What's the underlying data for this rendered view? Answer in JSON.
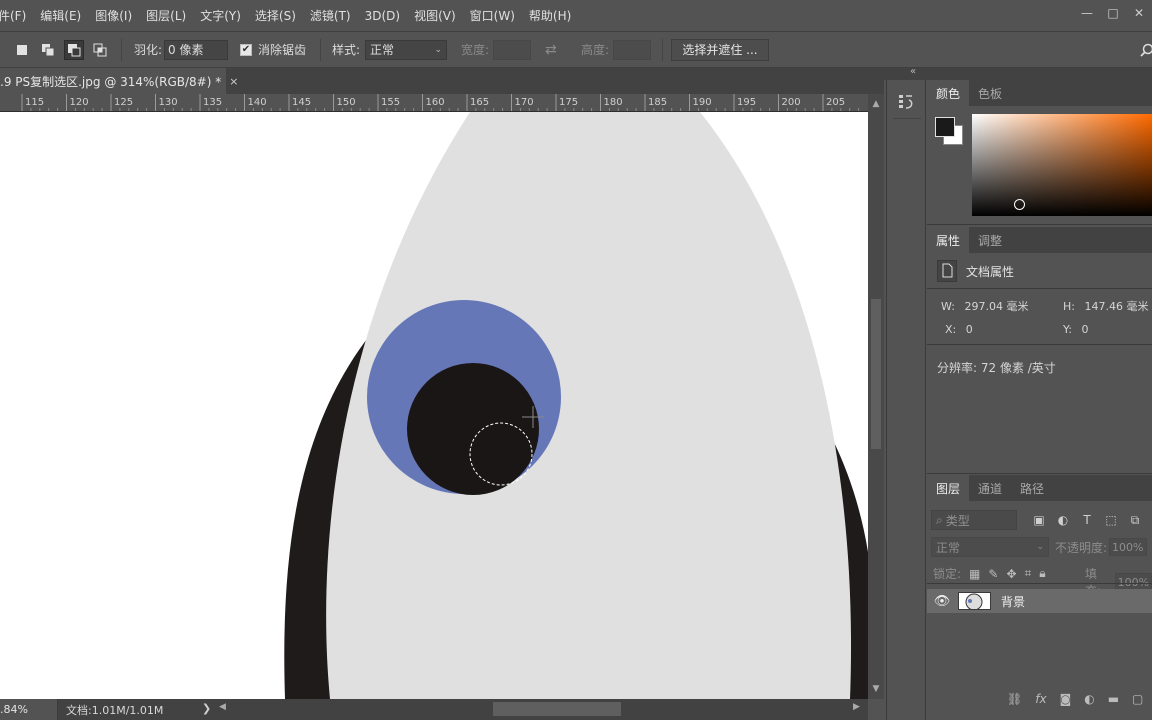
{
  "menubar": {
    "items": [
      "件(F)",
      "编辑(E)",
      "图像(I)",
      "图层(L)",
      "文字(Y)",
      "选择(S)",
      "滤镜(T)",
      "3D(D)",
      "视图(V)",
      "窗口(W)",
      "帮助(H)"
    ],
    "window_controls": [
      "—",
      "□",
      "✕"
    ]
  },
  "options": {
    "feather_label": "羽化:",
    "feather_value": "0 像素",
    "antialias_label": "消除锯齿",
    "antialias_checked": true,
    "style_label": "样式:",
    "style_value": "正常",
    "width_label": "宽度:",
    "height_label": "高度:",
    "select_mask_button": "选择并遮住 ..."
  },
  "document": {
    "tab_title": ".9 PS复制选区.jpg @ 314%(RGB/8#) *",
    "close": "×"
  },
  "ruler": {
    "labels": [
      "115",
      "120",
      "125",
      "130",
      "135",
      "140",
      "145",
      "150",
      "155",
      "160",
      "165",
      "170",
      "175",
      "180",
      "185",
      "190",
      "195",
      "200",
      "205"
    ]
  },
  "status": {
    "zoom": ".84%",
    "doc_info": "文档:1.01M/1.01M",
    "arrow": "❯"
  },
  "color_panel": {
    "tabs": [
      "颜色",
      "色板"
    ],
    "active_tab": 0,
    "foreground": "#1a1a1a",
    "background": "#ffffff",
    "hue": "#ff6a00"
  },
  "properties_panel": {
    "tabs": [
      "属性",
      "调整"
    ],
    "active_tab": 0,
    "heading": "文档属性",
    "w_label": "W:",
    "w_value": "297.04 毫米",
    "h_label": "H:",
    "h_value": "147.46 毫米",
    "x_label": "X:",
    "x_value": "0",
    "y_label": "Y:",
    "y_value": "0",
    "resolution": "分辨率: 72 像素 /英寸"
  },
  "layers_panel": {
    "tabs": [
      "图层",
      "通道",
      "路径"
    ],
    "active_tab": 0,
    "filter_placeholder": "类型",
    "blend_mode": "正常",
    "opacity_label": "不透明度:",
    "opacity_value": "100%",
    "lock_label": "锁定:",
    "fill_label": "填充:",
    "fill_value": "100%",
    "layers": [
      {
        "name": "背景",
        "visible": true
      }
    ]
  },
  "canvas": {
    "face_color": "#e0e0e0",
    "outline_color": "#1f1b1b",
    "iris_color": "#6677b8",
    "pupil_color": "#1a1616"
  }
}
